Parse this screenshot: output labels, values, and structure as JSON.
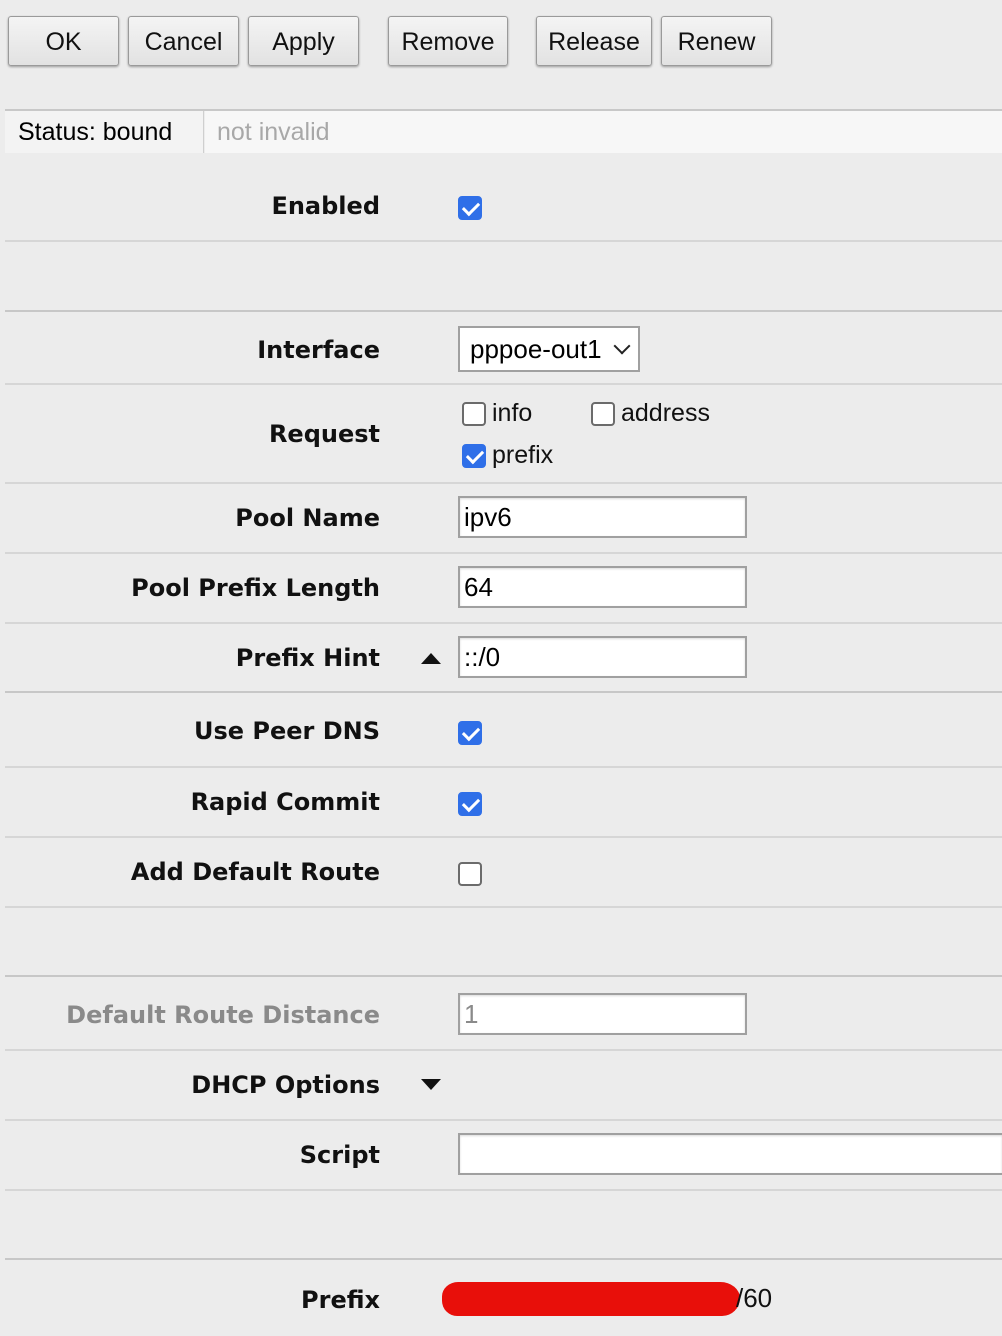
{
  "toolbar": {
    "ok": "OK",
    "cancel": "Cancel",
    "apply": "Apply",
    "remove": "Remove",
    "release": "Release",
    "renew": "Renew"
  },
  "status": {
    "text": "Status: bound",
    "secondary": "not invalid"
  },
  "form": {
    "enabled": {
      "label": "Enabled",
      "checked": true
    },
    "interface": {
      "label": "Interface",
      "value": "pppoe-out1"
    },
    "request": {
      "label": "Request",
      "options": [
        {
          "label": "info",
          "checked": false
        },
        {
          "label": "address",
          "checked": false
        },
        {
          "label": "prefix",
          "checked": true
        }
      ]
    },
    "pool_name": {
      "label": "Pool Name",
      "value": "ipv6"
    },
    "pool_prefix_length": {
      "label": "Pool Prefix Length",
      "value": "64"
    },
    "prefix_hint": {
      "label": "Prefix Hint",
      "value": "::/0"
    },
    "use_peer_dns": {
      "label": "Use Peer DNS",
      "checked": true
    },
    "rapid_commit": {
      "label": "Rapid Commit",
      "checked": true
    },
    "add_default_route": {
      "label": "Add Default Route",
      "checked": false
    },
    "default_route_distance": {
      "label": "Default Route Distance",
      "value": "1"
    },
    "dhcp_options": {
      "label": "DHCP Options"
    },
    "script": {
      "label": "Script",
      "value": ""
    },
    "prefix": {
      "label": "Prefix",
      "visible_suffix": "/60"
    }
  },
  "colors": {
    "accent": "#2f6fe8",
    "redaction": "#e80f0a",
    "background": "#ececec"
  },
  "icons": {
    "collapse": "triangle-up-icon",
    "expand": "triangle-down-icon",
    "dropdown": "chevron-down-icon",
    "checkmark": "checkmark-icon"
  }
}
